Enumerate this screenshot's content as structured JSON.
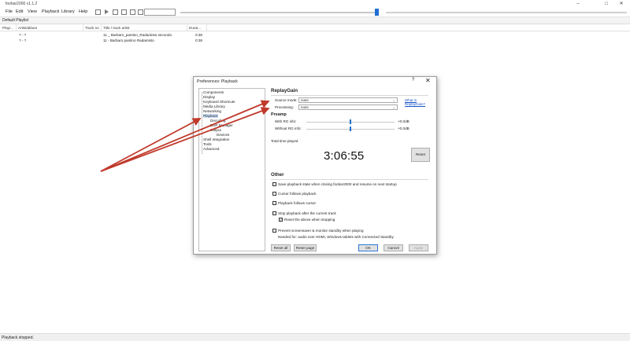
{
  "window": {
    "title": "foobar2000 v1.1.2",
    "minimize": "–",
    "maximize": "□",
    "close": "✕"
  },
  "menu": [
    "File",
    "Edit",
    "View",
    "Playback",
    "Library",
    "Help"
  ],
  "tabs": [
    "Default Playlist"
  ],
  "playlist": {
    "columns": [
      "Playi...",
      "Artist/album",
      "Track no",
      "Title / track artist",
      "Durat..."
    ],
    "rows": [
      {
        "artist_album": "? - ?",
        "track_no": "",
        "title": "11 _ Barbaro_pantino_Radamisto secondo",
        "duration": "0:38"
      },
      {
        "artist_album": "? - ?",
        "track_no": "",
        "title": "11 - Barbaro pantino Radamisto",
        "duration": "0:38"
      }
    ]
  },
  "status": "Playback stopped.",
  "dialog": {
    "title": "Preferences: Playback",
    "help": "?",
    "close": "✕",
    "tree": [
      "Components",
      "Display",
      "Keyboard Shortcuts",
      "Media Library",
      "Networking",
      "Playback",
      "Decoding",
      "DSP Manager",
      "Output",
      "Devices",
      "Shell Integration",
      "Tools",
      "Advanced"
    ],
    "replaygain": {
      "heading": "ReplayGain",
      "source_mode_label": "Source mode:",
      "source_mode_value": "none",
      "processing_label": "Processing:",
      "processing_value": "none",
      "link": "What is ReplayGain?"
    },
    "preamp": {
      "heading": "Preamp",
      "with_rg_label": "With RG info:",
      "with_rg_value": "+0.0dB",
      "with_rg_level": 0.5,
      "without_rg_label": "Without RG info:",
      "without_rg_value": "+0.0dB",
      "without_rg_level": 0.5
    },
    "total_time_label": "Total time played",
    "total_time": "3:06:55",
    "reset_label": "Reset",
    "other": {
      "heading": "Other",
      "options": [
        {
          "label": "Save playback state when closing foobar2000 and resume on next startup",
          "checked": false
        },
        {
          "label": "Cursor follows playback",
          "checked": false
        },
        {
          "label": "Playback follows cursor",
          "checked": false
        },
        {
          "label": "Stop playback after the current track",
          "checked": false
        },
        {
          "label": "Reset the above when stopping",
          "checked": true
        },
        {
          "label": "Prevent screensaver & monitor standby when playing",
          "checked": false
        }
      ],
      "note": "Needed for: audio over HDMI, Windows tablets with Connected Standby"
    },
    "buttons": {
      "reset_all": "Reset all",
      "reset_page": "Reset page",
      "ok": "OK",
      "cancel": "Cancel",
      "apply": "Apply"
    }
  },
  "colors": {
    "accent": "#1f6fd1",
    "arrow": "#c0392b",
    "selection": "#cfe3fb"
  }
}
